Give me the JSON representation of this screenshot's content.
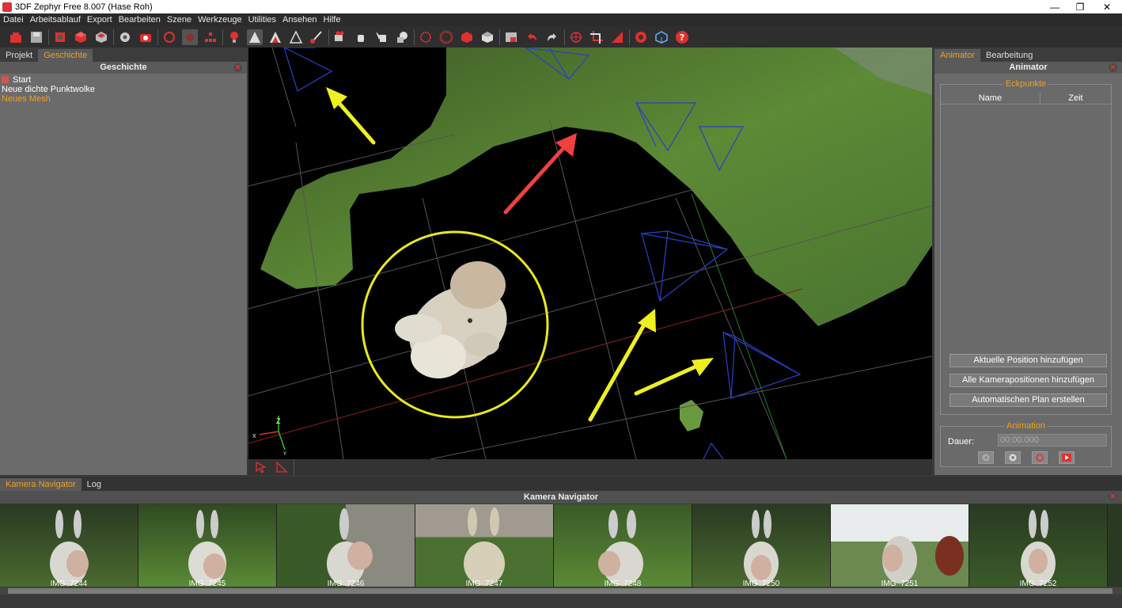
{
  "window": {
    "title": "3DF Zephyr Free 8.007 (Hase Roh)"
  },
  "menu": [
    "Datei",
    "Arbeitsablauf",
    "Export",
    "Bearbeiten",
    "Szene",
    "Werkzeuge",
    "Utilities",
    "Ansehen",
    "Hilfe"
  ],
  "left_panel": {
    "tabs": [
      "Projekt",
      "Geschichte"
    ],
    "selected_tab": "Geschichte",
    "header": "Geschichte",
    "history": [
      "Start",
      "Neue dichte Punktwolke",
      "Neues Mesh"
    ]
  },
  "viewport": {
    "axes": {
      "z": "Z",
      "x": "X",
      "y": "Y"
    }
  },
  "right_panel": {
    "tabs": [
      "Animator",
      "Bearbeitung"
    ],
    "selected_tab": "Animator",
    "header": "Animator",
    "keyframes_group": "Eckpunkte",
    "table_cols": [
      "Name",
      "Zeit"
    ],
    "buttons": [
      "Aktuelle Position hinzufügen",
      "Alle Kamerapositionen hinzufügen",
      "Automatischen Plan erstellen"
    ],
    "animation_group": "Animation",
    "duration_label": "Dauer:",
    "duration_value": "00:00.000"
  },
  "navigator": {
    "tabs": [
      "Kamera Navigator",
      "Log"
    ],
    "selected_tab": "Kamera Navigator",
    "header": "Kamera Navigator",
    "images": [
      "IMG_7244",
      "IMG_7245",
      "IMG_7246",
      "IMG_7247",
      "IMG_7248",
      "IMG_7250",
      "IMG_7251",
      "IMG_7252"
    ]
  },
  "colors": {
    "accent": "#f0a020",
    "icon_red": "#e03030",
    "camera_blue": "#2040c0",
    "arrow_yellow": "#f0f000",
    "arrow_red": "#f04040"
  }
}
